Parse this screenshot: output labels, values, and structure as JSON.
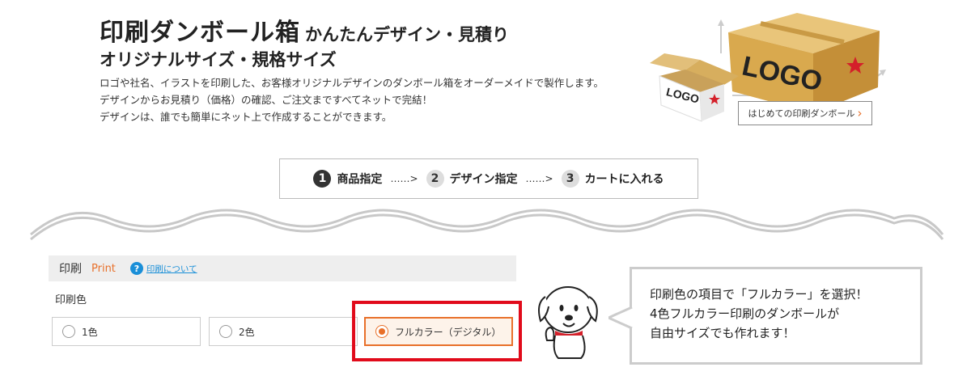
{
  "header": {
    "title": "印刷ダンボール箱",
    "title_sub": "かんたんデザイン・見積り",
    "subtitle": "オリジナルサイズ・規格サイズ",
    "description": [
      "ロゴや社名、イラストを印刷した、お客様オリジナルデザインのダンボール箱をオーダーメイドで製作します。",
      "デザインからお見積り（価格）の確認、ご注文まですべてネットで完結！",
      "デザインは、誰でも簡単にネット上で作成することができます。"
    ],
    "illustration": {
      "big_box_text": "LOGO",
      "small_box_text": "LOGO",
      "accent_colors": {
        "box": "#d9a94e",
        "star": "#d4202a"
      }
    },
    "guide_button": "はじめての印刷ダンボール",
    "guide_icon": "chevron-right-icon"
  },
  "steps": [
    {
      "num": "1",
      "label": "商品指定",
      "active": true
    },
    {
      "num": "2",
      "label": "デザイン指定",
      "active": false
    },
    {
      "num": "3",
      "label": "カートに入れる",
      "active": false
    }
  ],
  "step_arrow": "……>",
  "print_section": {
    "title": "印刷",
    "title_en": "Print",
    "help_icon": "?",
    "help_link": "印刷について",
    "color_label": "印刷色",
    "options": [
      {
        "label": "1色",
        "selected": false
      },
      {
        "label": "2色",
        "selected": false
      },
      {
        "label": "フルカラー（デジタル）",
        "selected": true
      }
    ],
    "accent_color": "#e8702a",
    "highlight_color": "#e10b1b"
  },
  "callout": {
    "lines": [
      "印刷色の項目で「フルカラー」を選択！",
      "4色フルカラー印刷のダンボールが",
      "自由サイズでも作れます！"
    ]
  }
}
